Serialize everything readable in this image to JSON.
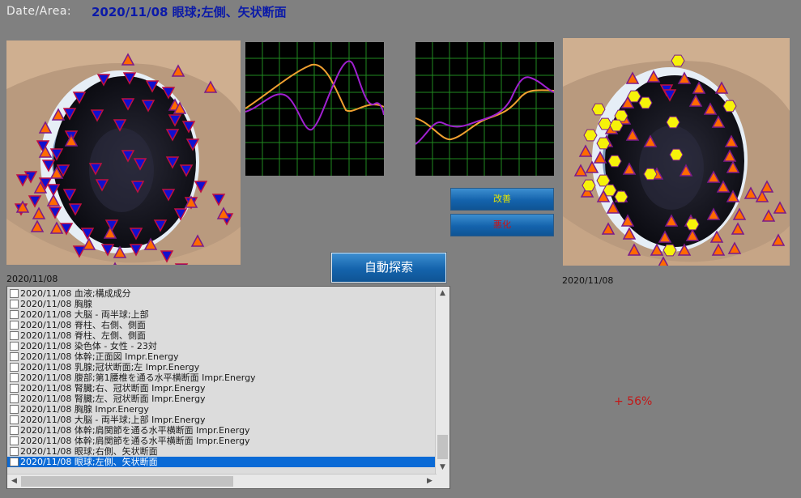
{
  "header": {
    "label": "Date/Area:",
    "value": "2020/11/08 眼球;左側、矢状断面"
  },
  "left_image": {
    "date": "2020/11/08"
  },
  "right_image": {
    "date": "2020/11/08"
  },
  "buttons": {
    "improve": "改善",
    "worsen": "悪化",
    "auto_search": "自動探索"
  },
  "colors": {
    "header_value": "#0b1aa8",
    "improve_text": "#e6e600",
    "worsen_text": "#d01010",
    "graph_grid": "#1f8a1f",
    "curve_orange": "#f0a030",
    "curve_purple": "#a020d0",
    "marker_orange": "#ff6a00",
    "marker_blue": "#1010d0",
    "marker_yellow": "#f6f20a"
  },
  "list": {
    "items": [
      "2020/11/08  血液;構成成分",
      "2020/11/08  胸腺",
      "2020/11/08  大脳 - 両半球;上部",
      "2020/11/08  脊柱、右側、側面",
      "2020/11/08  脊柱、左側、側面",
      "2020/11/08  染色体 - 女性 - 23対",
      "2020/11/08  体幹;正面図  Impr.Energy",
      "2020/11/08  乳腺;冠状断面;左  Impr.Energy",
      "2020/11/08  腹部;第1腰椎を通る水平横断面  Impr.Energy",
      "2020/11/08  腎臓;右、冠状断面  Impr.Energy",
      "2020/11/08  腎臓;左、冠状断面  Impr.Energy",
      "2020/11/08  胸腺  Impr.Energy",
      "2020/11/08  大脳 - 両半球;上部  Impr.Energy",
      "2020/11/08  体幹;肩関節を通る水平横断面  Impr.Energy",
      "2020/11/08  体幹;肩関節を通る水平横断面  Impr.Energy",
      "2020/11/08  眼球;右側、矢状断面",
      "2020/11/08  眼球;左側、矢状断面"
    ],
    "selected_index": 16
  },
  "result": {
    "percent": "+ 56%"
  }
}
